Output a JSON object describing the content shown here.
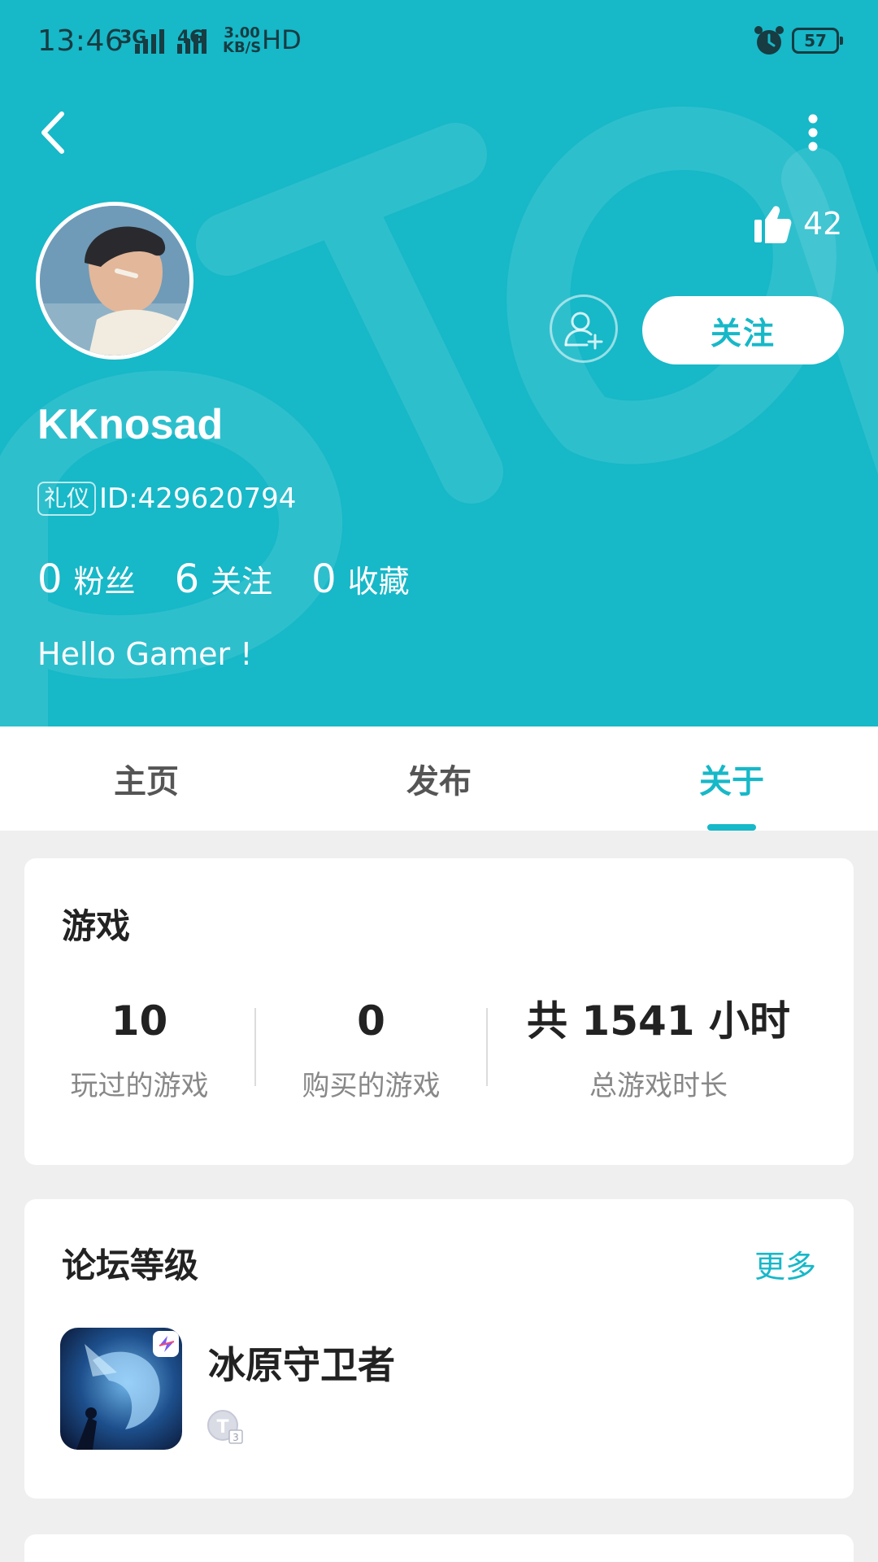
{
  "status_bar": {
    "time": "13:46",
    "net1": "3G",
    "net2": "4G",
    "speed_top": "3.00",
    "speed_bottom": "KB/S",
    "hd": "HD",
    "battery": "57"
  },
  "profile": {
    "username": "KKnosad",
    "badge": "礼仪",
    "id": "ID:429620794",
    "likes": "42",
    "follow_label": "关注",
    "bio": "Hello Gamer !",
    "stats": [
      {
        "num": "0",
        "label": "粉丝"
      },
      {
        "num": "6",
        "label": "关注"
      },
      {
        "num": "0",
        "label": "收藏"
      }
    ]
  },
  "tabs": [
    {
      "label": "主页",
      "active": false
    },
    {
      "label": "发布",
      "active": false
    },
    {
      "label": "关于",
      "active": true
    }
  ],
  "games": {
    "title": "游戏",
    "stats": [
      {
        "value": "10",
        "label": "玩过的游戏"
      },
      {
        "value": "0",
        "label": "购买的游戏"
      },
      {
        "value": "共 1541 小时",
        "label": "总游戏时长"
      }
    ]
  },
  "forum_level": {
    "title": "论坛等级",
    "more": "更多",
    "game_name": "冰原守卫者",
    "level_icon": "t3-level-badge-icon"
  },
  "colors": {
    "accent": "#17b8c8",
    "card_bg": "#ffffff",
    "page_bg": "#efefef"
  }
}
